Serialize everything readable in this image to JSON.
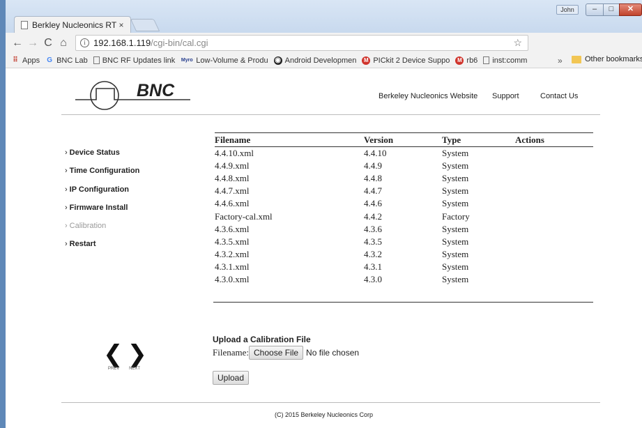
{
  "browser": {
    "tab_title": "Berkley Nucleonics RTSA",
    "tab_close": "×",
    "user_badge": "John",
    "url_host": "192.168.1.119",
    "url_path": "/cgi-bin/cal.cgi",
    "info_icon": "i"
  },
  "bookmarks": {
    "items": [
      {
        "label": "Apps",
        "icon": "apps-grid-icon"
      },
      {
        "label": "BNC Lab",
        "icon": "google-icon"
      },
      {
        "label": "BNC RF Updates link",
        "icon": "page-icon"
      },
      {
        "label": "Low-Volume & Produ",
        "icon": "myro-icon"
      },
      {
        "label": "Android Developmen",
        "icon": "android-icon"
      },
      {
        "label": "PICkit 2 Device Suppo",
        "icon": "microchip-icon"
      },
      {
        "label": "rb6",
        "icon": "microchip-icon"
      },
      {
        "label": "inst:comm",
        "icon": "page-icon"
      }
    ],
    "more": "»",
    "other": "Other bookmarks"
  },
  "site": {
    "logo_text": "BNC",
    "nav": [
      "Berkeley Nucleonics Website",
      "Support",
      "Contact Us"
    ],
    "sidebar": [
      {
        "label": "Device Status",
        "disabled": false
      },
      {
        "label": "Time Configuration",
        "disabled": false
      },
      {
        "label": "IP Configuration",
        "disabled": false
      },
      {
        "label": "Firmware Install",
        "disabled": false
      },
      {
        "label": "Calibration",
        "disabled": true
      },
      {
        "label": "Restart",
        "disabled": false
      }
    ]
  },
  "table": {
    "headers": [
      "Filename",
      "Version",
      "Type",
      "Actions"
    ],
    "rows": [
      [
        "4.4.10.xml",
        "4.4.10",
        "System",
        ""
      ],
      [
        "4.4.9.xml",
        "4.4.9",
        "System",
        ""
      ],
      [
        "4.4.8.xml",
        "4.4.8",
        "System",
        ""
      ],
      [
        "4.4.7.xml",
        "4.4.7",
        "System",
        ""
      ],
      [
        "4.4.6.xml",
        "4.4.6",
        "System",
        ""
      ],
      [
        "Factory-cal.xml",
        "4.4.2",
        "Factory",
        ""
      ],
      [
        "4.3.6.xml",
        "4.3.6",
        "System",
        ""
      ],
      [
        "4.3.5.xml",
        "4.3.5",
        "System",
        ""
      ],
      [
        "4.3.2.xml",
        "4.3.2",
        "System",
        ""
      ],
      [
        "4.3.1.xml",
        "4.3.1",
        "System",
        ""
      ],
      [
        "4.3.0.xml",
        "4.3.0",
        "System",
        ""
      ]
    ]
  },
  "pager": {
    "prev": "PREV",
    "next": "NEXT"
  },
  "upload": {
    "heading": "Upload a Calibration File",
    "filename_label": "Filename:",
    "choose_label": "Choose File",
    "no_file": "No file chosen",
    "upload_label": "Upload"
  },
  "footer": "(C) 2015 Berkeley Nucleonics Corp"
}
